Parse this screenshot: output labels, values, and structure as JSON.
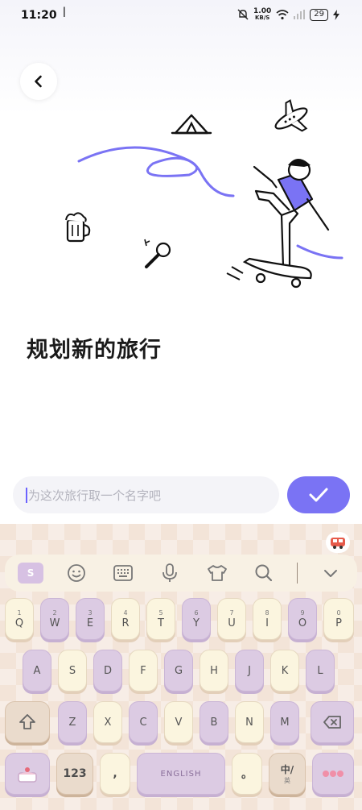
{
  "status": {
    "time": "11:20",
    "speed_value": "1.00",
    "speed_unit": "KB/S",
    "battery": "29"
  },
  "page": {
    "title": "规划新的旅行",
    "input_placeholder": "为这次旅行取一个名字吧"
  },
  "keyboard": {
    "numbers": [
      "1",
      "2",
      "3",
      "4",
      "5",
      "6",
      "7",
      "8",
      "9",
      "0"
    ],
    "row1": [
      "Q",
      "W",
      "E",
      "R",
      "T",
      "Y",
      "U",
      "I",
      "O",
      "P"
    ],
    "row2": [
      "A",
      "S",
      "D",
      "F",
      "G",
      "H",
      "J",
      "K",
      "L"
    ],
    "row3": [
      "Z",
      "X",
      "C",
      "V",
      "B",
      "N",
      "M"
    ],
    "num_key": "123",
    "comma_key": ",",
    "period_key": "。",
    "lang_key": "中/",
    "lang_key_sub": "英",
    "space_label": "ENGLISH"
  },
  "colors": {
    "accent": "#7a73f4",
    "keyboard_bg": "#f3e4d8",
    "key_cream": "#fbf5df",
    "key_purple": "#dccbe3"
  },
  "icons": [
    "back-icon",
    "check-icon",
    "emoji-icon",
    "keyboard-icon",
    "mic-icon",
    "clothes-icon",
    "search-icon",
    "collapse-icon",
    "shift-icon",
    "delete-icon"
  ]
}
